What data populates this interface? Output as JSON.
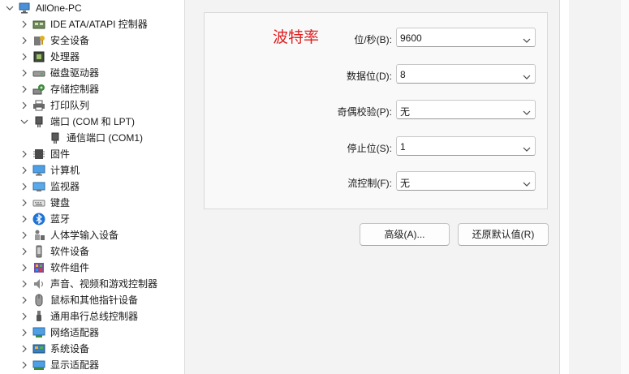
{
  "tree": {
    "root": {
      "label": "AllOne-PC",
      "icon": "computer-icon"
    },
    "items": [
      {
        "label": "IDE ATA/ATAPI 控制器",
        "icon": "ide-controller-icon",
        "expanded": false
      },
      {
        "label": "安全设备",
        "icon": "security-device-icon",
        "expanded": false
      },
      {
        "label": "处理器",
        "icon": "processor-icon",
        "expanded": false
      },
      {
        "label": "磁盘驱动器",
        "icon": "disk-drive-icon",
        "expanded": false
      },
      {
        "label": "存储控制器",
        "icon": "storage-controller-icon",
        "expanded": false
      },
      {
        "label": "打印队列",
        "icon": "printer-icon",
        "expanded": false
      },
      {
        "label": "端口 (COM 和 LPT)",
        "icon": "port-icon",
        "expanded": true
      },
      {
        "label": "通信端口 (COM1)",
        "icon": "port-icon",
        "child": true
      },
      {
        "label": "固件",
        "icon": "firmware-icon",
        "expanded": false
      },
      {
        "label": "计算机",
        "icon": "computer-monitor-icon",
        "expanded": false
      },
      {
        "label": "监视器",
        "icon": "monitor-icon",
        "expanded": false
      },
      {
        "label": "键盘",
        "icon": "keyboard-icon",
        "expanded": false
      },
      {
        "label": "蓝牙",
        "icon": "bluetooth-icon",
        "expanded": false
      },
      {
        "label": "人体学输入设备",
        "icon": "hid-icon",
        "expanded": false
      },
      {
        "label": "软件设备",
        "icon": "software-device-icon",
        "expanded": false
      },
      {
        "label": "软件组件",
        "icon": "software-component-icon",
        "expanded": false
      },
      {
        "label": "声音、视频和游戏控制器",
        "icon": "speaker-icon",
        "expanded": false
      },
      {
        "label": "鼠标和其他指针设备",
        "icon": "mouse-icon",
        "expanded": false
      },
      {
        "label": "通用串行总线控制器",
        "icon": "usb-icon",
        "expanded": false
      },
      {
        "label": "网络适配器",
        "icon": "network-adapter-icon",
        "expanded": false
      },
      {
        "label": "系统设备",
        "icon": "system-device-icon",
        "expanded": false
      },
      {
        "label": "显示适配器",
        "icon": "display-adapter-icon",
        "expanded": false
      }
    ]
  },
  "port_settings": {
    "annotation": "波特率",
    "fields": [
      {
        "label": "位/秒(B):",
        "value": "9600"
      },
      {
        "label": "数据位(D):",
        "value": "8"
      },
      {
        "label": "奇偶校验(P):",
        "value": "无"
      },
      {
        "label": "停止位(S):",
        "value": "1"
      },
      {
        "label": "流控制(F):",
        "value": "无"
      }
    ],
    "advanced_button": "高级(A)...",
    "restore_defaults_button": "还原默认值(R)"
  },
  "colors": {
    "annotation": "#e01e1e",
    "dialog_bg": "#f3f3f3",
    "bluetooth": "#1e74d6"
  }
}
